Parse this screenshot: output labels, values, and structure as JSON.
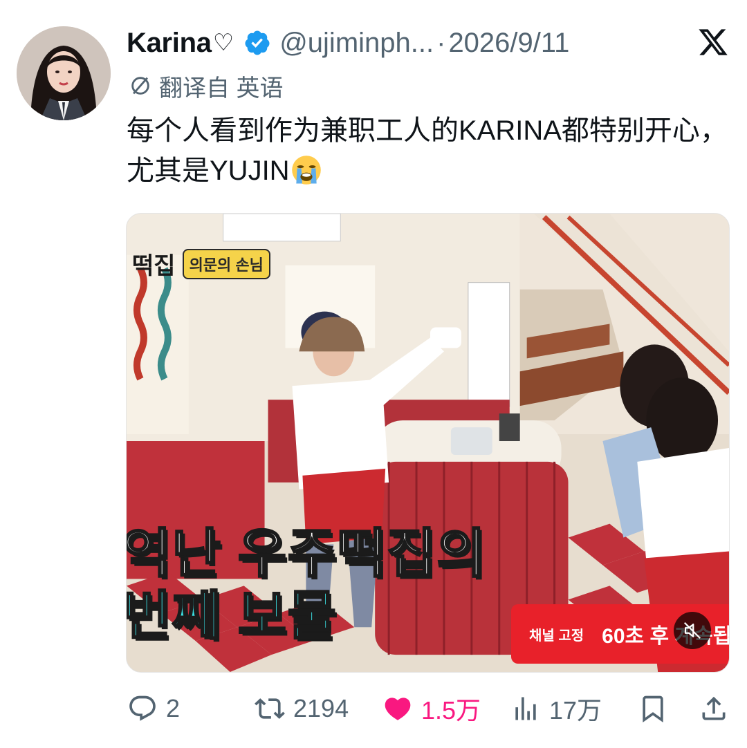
{
  "author": {
    "name": "Karina",
    "name_suffix": "♡",
    "handle": "@ujiminph...",
    "separator": "·",
    "date": "2026/9/11",
    "verified": true
  },
  "translation": {
    "label": "翻译自 英语",
    "icon": "translate-icon"
  },
  "tweet": {
    "text": "每个人看到作为兼职工人的KARINA都特别开心，尤其是YUJIN",
    "emoji": "loudly-crying-face-emoji"
  },
  "media": {
    "overlay_title": "떡집",
    "overlay_tag": "의문의 손님",
    "caption_line1": "역난 우주떡집의",
    "caption_line2": "번째 보물",
    "banner_left": "채널 고정",
    "banner_right": "60초 후 계속됩",
    "mute_icon": "muted-speaker-icon"
  },
  "actions": {
    "reply": {
      "icon": "reply-icon",
      "count": "2"
    },
    "retweet": {
      "icon": "retweet-icon",
      "count": "2194"
    },
    "like": {
      "icon": "heart-filled-icon",
      "count": "1.5万",
      "color": "#f91880"
    },
    "views": {
      "icon": "views-icon",
      "count": "17万"
    },
    "bookmark": {
      "icon": "bookmark-icon"
    },
    "share": {
      "icon": "share-icon"
    }
  },
  "colors": {
    "text_primary": "#0f1419",
    "text_secondary": "#536471",
    "verified_blue": "#1d9bf0",
    "like_pink": "#f91880",
    "caption_cyan": "#3ce3e6",
    "banner_red": "#e8212a"
  }
}
